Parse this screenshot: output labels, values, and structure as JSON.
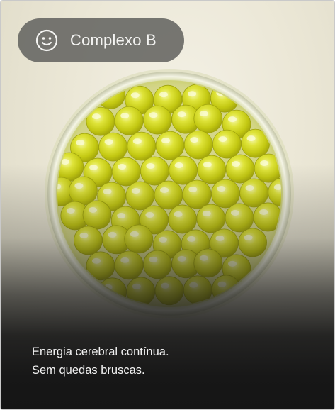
{
  "product": {
    "badge_icon": "smiley-icon",
    "badge_label": "Complexo B"
  },
  "image": {
    "subject": "dish-of-softgel-capsules"
  },
  "caption": {
    "line1": "Energia cerebral contínua.",
    "line2": "Sem quedas bruscas."
  },
  "colors": {
    "capsule": "#d6dc1c",
    "capsule_highlight": "#f3f6a0",
    "badge_bg": "#646461",
    "text": "#f2f2f2",
    "bottom_bg": "#161616"
  }
}
